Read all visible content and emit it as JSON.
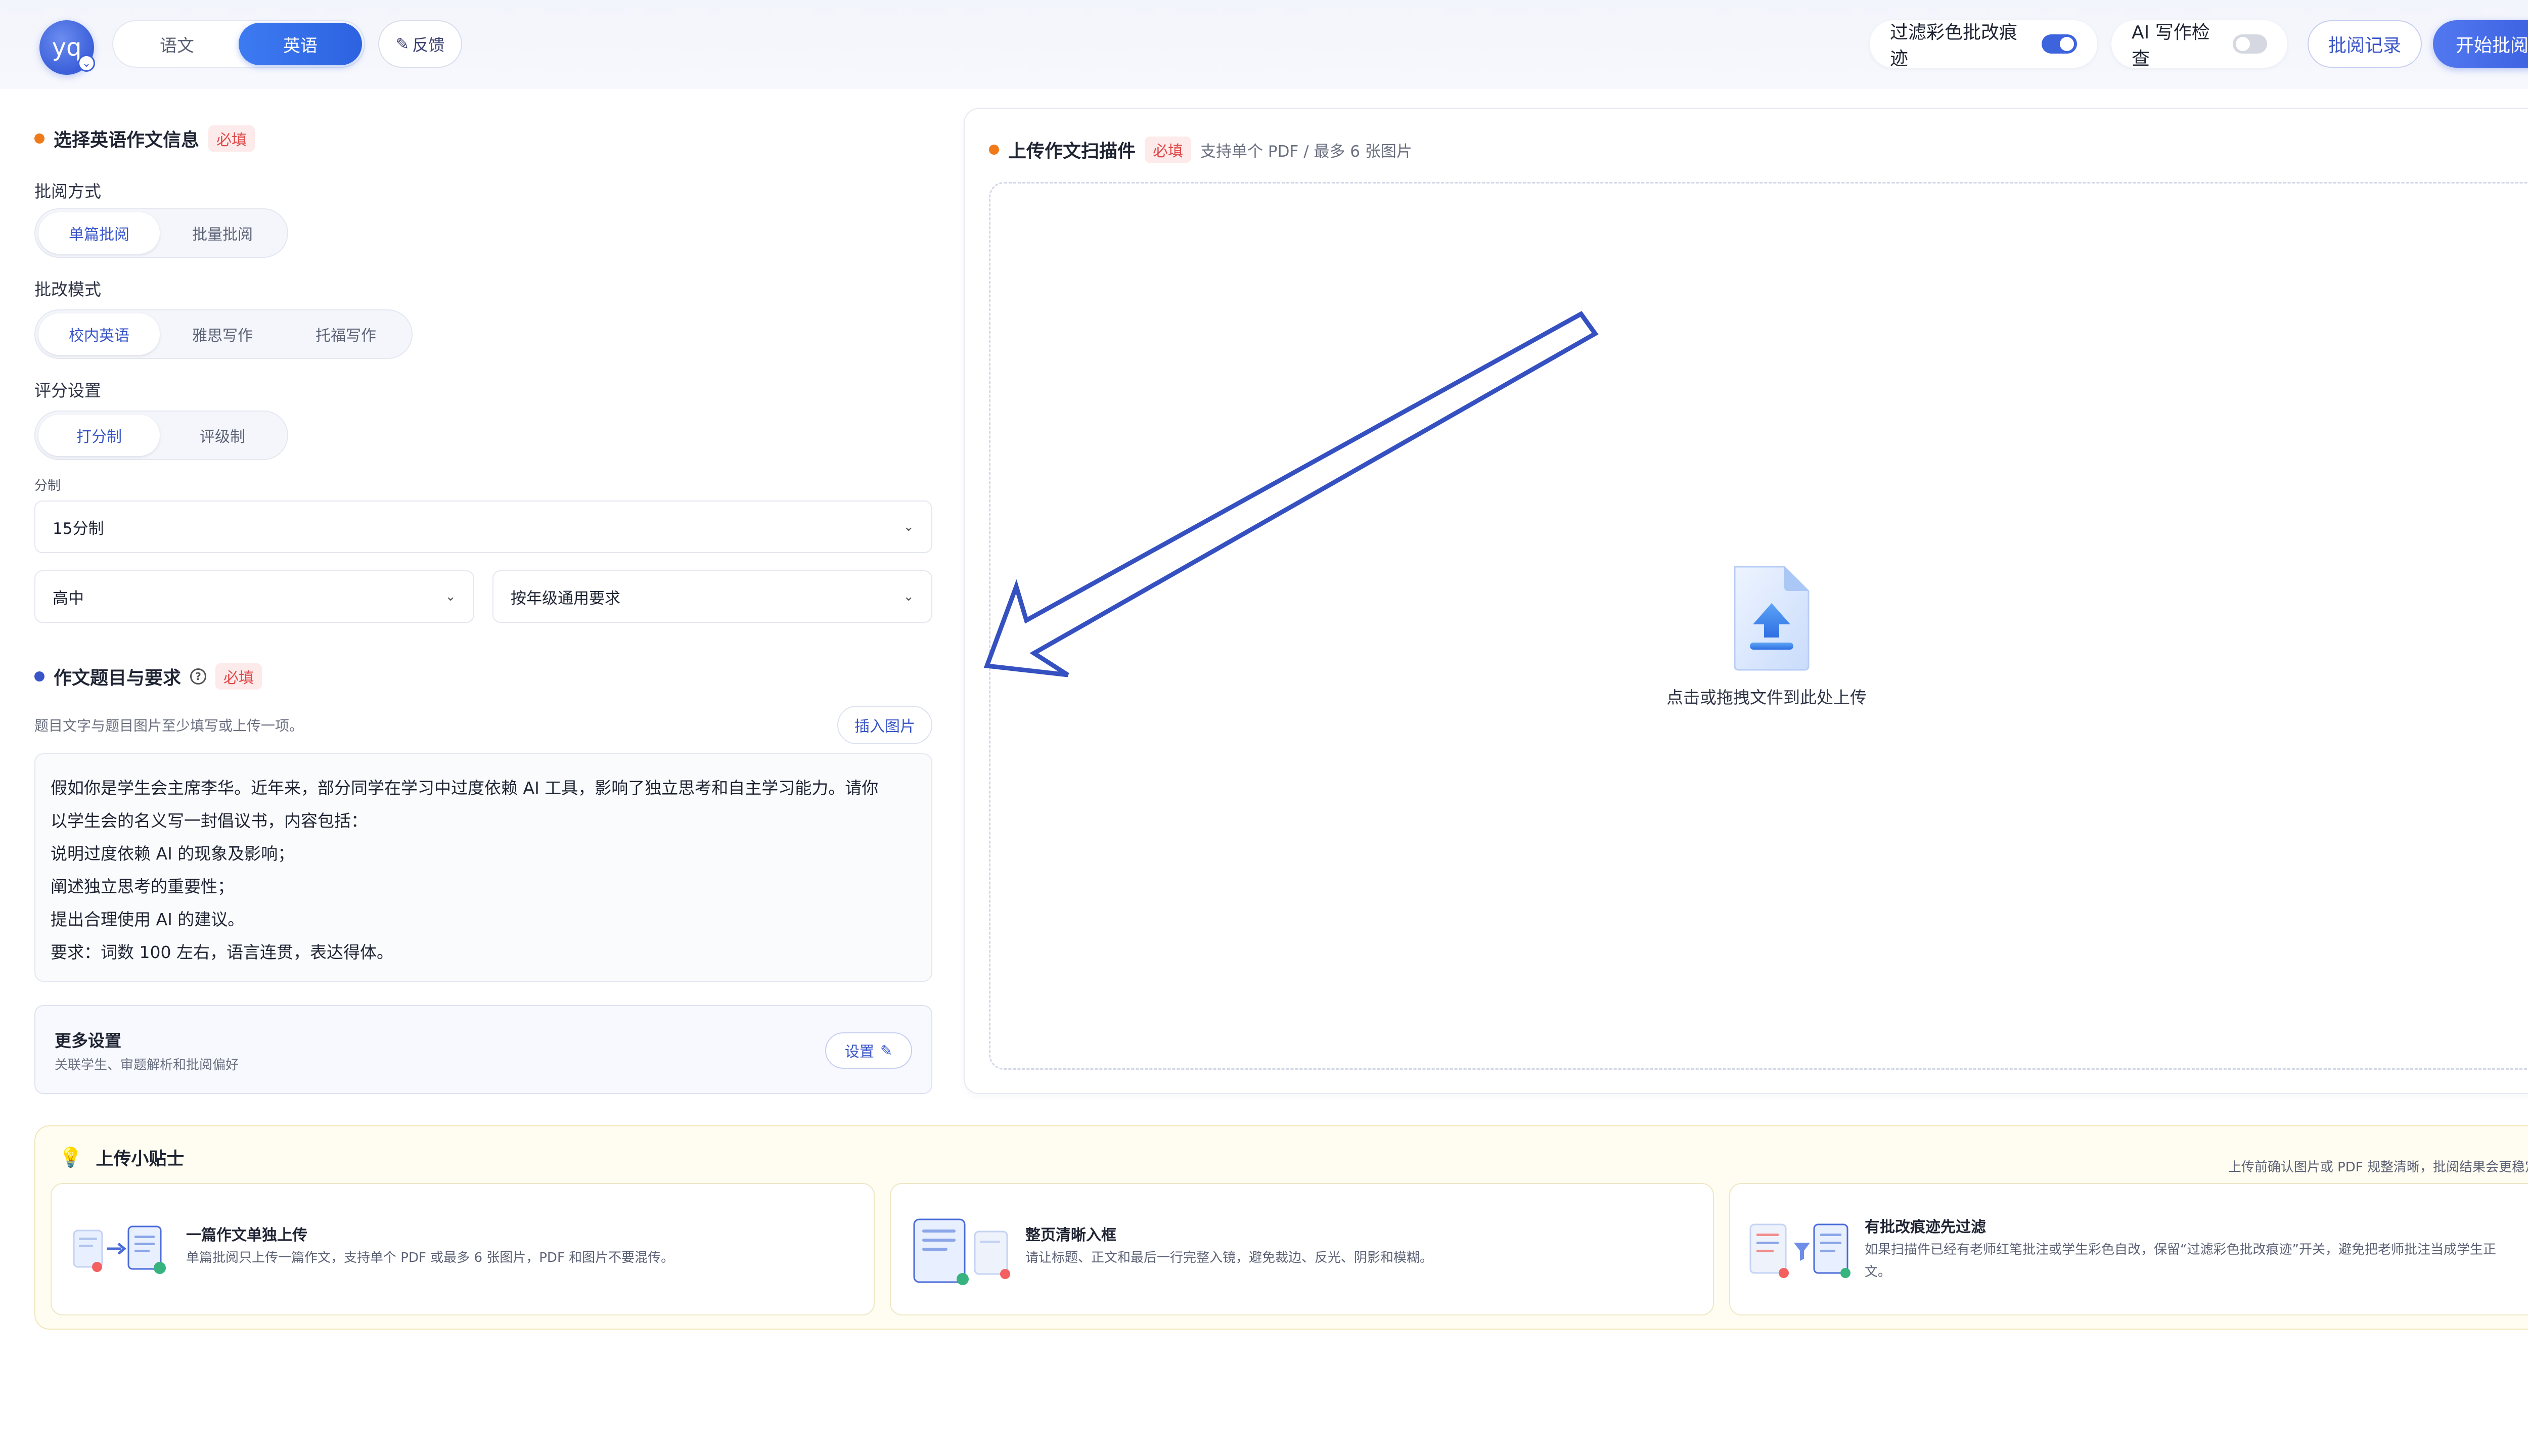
{
  "header": {
    "avatar_text": "yq",
    "subjects": [
      "语文",
      "英语"
    ],
    "active_subject": "英语",
    "feedback_label": "反馈",
    "filter_marks_label": "过滤彩色批改痕迹",
    "filter_marks_on": true,
    "ai_check_label": "AI 写作检查",
    "ai_check_on": false,
    "history_label": "批阅记录",
    "start_label": "开始批阅"
  },
  "info": {
    "title": "选择英语作文信息",
    "required": "必填",
    "method_label": "批阅方式",
    "methods": [
      "单篇批阅",
      "批量批阅"
    ],
    "mode_label": "批改模式",
    "modes": [
      "校内英语",
      "雅思写作",
      "托福写作"
    ],
    "score_label": "评分设置",
    "scores": [
      "打分制",
      "评级制"
    ],
    "scale_label": "分制",
    "scale_value": "15分制",
    "grade_value": "高中",
    "req_value": "按年级通用要求"
  },
  "prompt": {
    "title": "作文题目与要求",
    "required": "必填",
    "help_icon": "question-circle-icon",
    "hint": "题目文字与题目图片至少填写或上传一项。",
    "insert_label": "插入图片",
    "lines": [
      "假如你是学生会主席李华。近年来，部分同学在学习中过度依赖 AI 工具，影响了独立思考和自主学习能力。请你",
      "以学生会的名义写一封倡议书，内容包括：",
      "说明过度依赖 AI 的现象及影响；",
      "阐述独立思考的重要性；",
      "提出合理使用 AI 的建议。",
      "要求：词数 100 左右，语言连贯，表达得体。"
    ]
  },
  "more": {
    "title": "更多设置",
    "desc": "关联学生、审题解析和批阅偏好",
    "button": "设置"
  },
  "upload": {
    "title": "上传作文扫描件",
    "required": "必填",
    "support": "支持单个 PDF / 最多 6 张图片",
    "drop_text": "点击或拖拽文件到此处上传"
  },
  "tips": {
    "title": "上传小贴士",
    "note": "上传前确认图片或 PDF 规整清晰，批阅结果会更稳定。",
    "items": [
      {
        "title": "一篇作文单独上传",
        "desc": "单篇批阅只上传一篇作文，支持单个 PDF 或最多 6 张图片，PDF 和图片不要混传。"
      },
      {
        "title": "整页清晰入框",
        "desc": "请让标题、正文和最后一行完整入镜，避免裁边、反光、阴影和模糊。"
      },
      {
        "title": "有批改痕迹先过滤",
        "desc_line1": "如果扫描件已经有老师红笔批注或学生彩色自改，保留“过滤彩色批改痕迹”开关，避免把老师批注当成学生正",
        "desc_line2": "文。"
      }
    ]
  },
  "colors": {
    "accent": "#3d63dd",
    "orange_dot": "#f07a1a",
    "blue_dot": "#3a55c8",
    "required_red": "#e04848",
    "arrow": "#3550c0"
  }
}
